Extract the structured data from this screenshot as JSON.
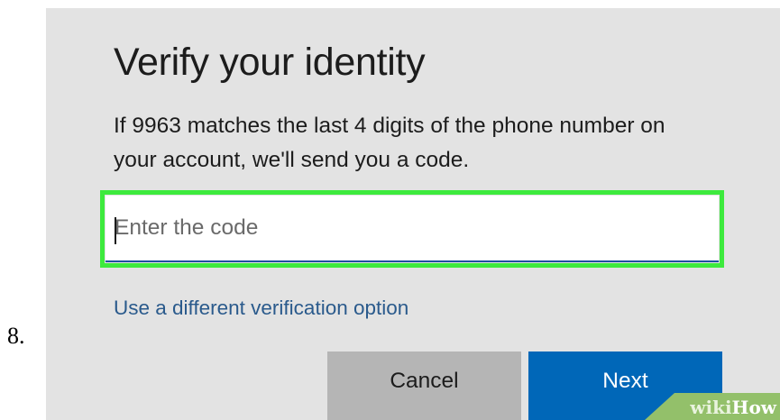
{
  "step": {
    "number": "8."
  },
  "dialog": {
    "title": "Verify your identity",
    "description": "If 9963 matches the last 4 digits of the phone number on your account, we'll send you a code.",
    "code_input": {
      "placeholder": "Enter the code",
      "value": ""
    },
    "alternate_option_link": "Use a different verification option",
    "buttons": {
      "cancel": "Cancel",
      "next": "Next"
    }
  },
  "watermark": {
    "part1": "wiki",
    "part2": "How"
  },
  "colors": {
    "panel_background": "#e3e3e3",
    "highlight_border": "#3dea3d",
    "input_underline": "#1f4fa2",
    "link": "#2a5a8c",
    "cancel_button": "#b5b5b5",
    "next_button": "#0067b8",
    "watermark": "#93c06a"
  }
}
